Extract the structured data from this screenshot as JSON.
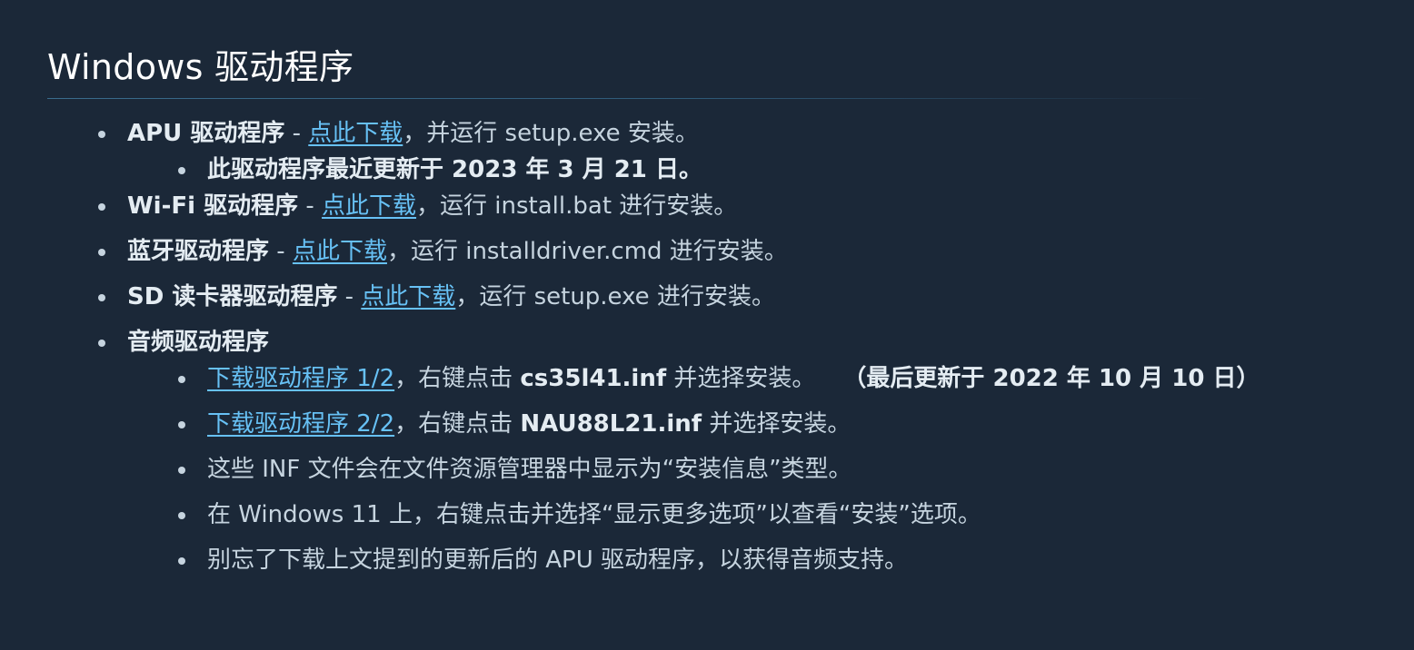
{
  "heading": "Windows 驱动程序",
  "apu": {
    "title": "APU 驱动程序",
    "sep": " - ",
    "link": "点此下载",
    "rest": "，并运行 setup.exe 安装。",
    "note": "此驱动程序最近更新于 2023 年 3 月 21 日。"
  },
  "wifi": {
    "title": "Wi-Fi 驱动程序",
    "sep": " - ",
    "link": "点此下载",
    "rest": "，运行 install.bat 进行安装。"
  },
  "bluetooth": {
    "title": "蓝牙驱动程序",
    "sep": " - ",
    "link": "点此下载",
    "rest": "，运行 installdriver.cmd 进行安装。"
  },
  "sdcard": {
    "title": "SD 读卡器驱动程序",
    "sep": " - ",
    "link": "点此下载",
    "rest": "，运行 setup.exe 进行安装。"
  },
  "audio": {
    "title": "音频驱动程序",
    "item1": {
      "link": "下载驱动程序 1/2",
      "pre": "，右键点击 ",
      "file": "cs35l41.inf",
      "post": " 并选择安装。",
      "updated": "（最后更新于 2022 年 10 月 10 日）"
    },
    "item2": {
      "link": "下载驱动程序 2/2",
      "pre": "，右键点击 ",
      "file": "NAU88L21.inf",
      "post": " 并选择安装。"
    },
    "item3": "这些 INF 文件会在文件资源管理器中显示为“安装信息”类型。",
    "item4": "在 Windows 11 上，右键点击并选择“显示更多选项”以查看“安装”选项。",
    "item5": "别忘了下载上文提到的更新后的 APU 驱动程序，以获得音频支持。"
  },
  "colors": {
    "background": "#1b2838",
    "text": "#c6d4df",
    "link": "#67c1f5",
    "heading": "#ffffff"
  }
}
